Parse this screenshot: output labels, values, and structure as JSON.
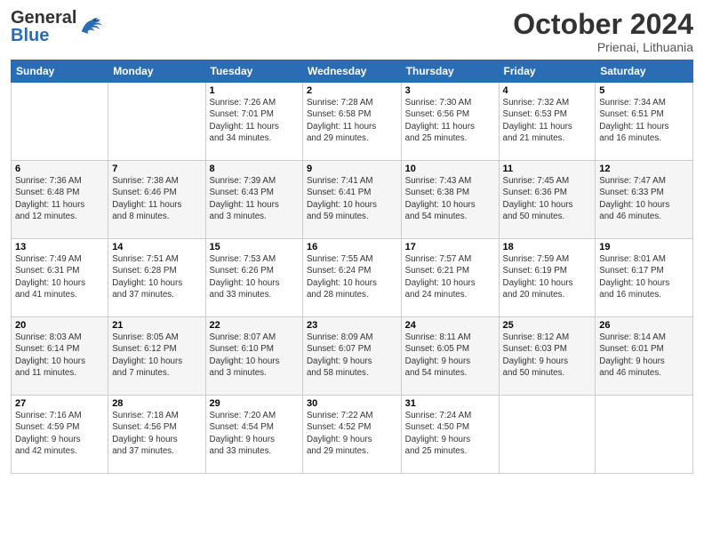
{
  "header": {
    "logo_general": "General",
    "logo_blue": "Blue",
    "month": "October 2024",
    "location": "Prienai, Lithuania"
  },
  "weekdays": [
    "Sunday",
    "Monday",
    "Tuesday",
    "Wednesday",
    "Thursday",
    "Friday",
    "Saturday"
  ],
  "weeks": [
    [
      {
        "day": "",
        "info": ""
      },
      {
        "day": "",
        "info": ""
      },
      {
        "day": "1",
        "info": "Sunrise: 7:26 AM\nSunset: 7:01 PM\nDaylight: 11 hours\nand 34 minutes."
      },
      {
        "day": "2",
        "info": "Sunrise: 7:28 AM\nSunset: 6:58 PM\nDaylight: 11 hours\nand 29 minutes."
      },
      {
        "day": "3",
        "info": "Sunrise: 7:30 AM\nSunset: 6:56 PM\nDaylight: 11 hours\nand 25 minutes."
      },
      {
        "day": "4",
        "info": "Sunrise: 7:32 AM\nSunset: 6:53 PM\nDaylight: 11 hours\nand 21 minutes."
      },
      {
        "day": "5",
        "info": "Sunrise: 7:34 AM\nSunset: 6:51 PM\nDaylight: 11 hours\nand 16 minutes."
      }
    ],
    [
      {
        "day": "6",
        "info": "Sunrise: 7:36 AM\nSunset: 6:48 PM\nDaylight: 11 hours\nand 12 minutes."
      },
      {
        "day": "7",
        "info": "Sunrise: 7:38 AM\nSunset: 6:46 PM\nDaylight: 11 hours\nand 8 minutes."
      },
      {
        "day": "8",
        "info": "Sunrise: 7:39 AM\nSunset: 6:43 PM\nDaylight: 11 hours\nand 3 minutes."
      },
      {
        "day": "9",
        "info": "Sunrise: 7:41 AM\nSunset: 6:41 PM\nDaylight: 10 hours\nand 59 minutes."
      },
      {
        "day": "10",
        "info": "Sunrise: 7:43 AM\nSunset: 6:38 PM\nDaylight: 10 hours\nand 54 minutes."
      },
      {
        "day": "11",
        "info": "Sunrise: 7:45 AM\nSunset: 6:36 PM\nDaylight: 10 hours\nand 50 minutes."
      },
      {
        "day": "12",
        "info": "Sunrise: 7:47 AM\nSunset: 6:33 PM\nDaylight: 10 hours\nand 46 minutes."
      }
    ],
    [
      {
        "day": "13",
        "info": "Sunrise: 7:49 AM\nSunset: 6:31 PM\nDaylight: 10 hours\nand 41 minutes."
      },
      {
        "day": "14",
        "info": "Sunrise: 7:51 AM\nSunset: 6:28 PM\nDaylight: 10 hours\nand 37 minutes."
      },
      {
        "day": "15",
        "info": "Sunrise: 7:53 AM\nSunset: 6:26 PM\nDaylight: 10 hours\nand 33 minutes."
      },
      {
        "day": "16",
        "info": "Sunrise: 7:55 AM\nSunset: 6:24 PM\nDaylight: 10 hours\nand 28 minutes."
      },
      {
        "day": "17",
        "info": "Sunrise: 7:57 AM\nSunset: 6:21 PM\nDaylight: 10 hours\nand 24 minutes."
      },
      {
        "day": "18",
        "info": "Sunrise: 7:59 AM\nSunset: 6:19 PM\nDaylight: 10 hours\nand 20 minutes."
      },
      {
        "day": "19",
        "info": "Sunrise: 8:01 AM\nSunset: 6:17 PM\nDaylight: 10 hours\nand 16 minutes."
      }
    ],
    [
      {
        "day": "20",
        "info": "Sunrise: 8:03 AM\nSunset: 6:14 PM\nDaylight: 10 hours\nand 11 minutes."
      },
      {
        "day": "21",
        "info": "Sunrise: 8:05 AM\nSunset: 6:12 PM\nDaylight: 10 hours\nand 7 minutes."
      },
      {
        "day": "22",
        "info": "Sunrise: 8:07 AM\nSunset: 6:10 PM\nDaylight: 10 hours\nand 3 minutes."
      },
      {
        "day": "23",
        "info": "Sunrise: 8:09 AM\nSunset: 6:07 PM\nDaylight: 9 hours\nand 58 minutes."
      },
      {
        "day": "24",
        "info": "Sunrise: 8:11 AM\nSunset: 6:05 PM\nDaylight: 9 hours\nand 54 minutes."
      },
      {
        "day": "25",
        "info": "Sunrise: 8:12 AM\nSunset: 6:03 PM\nDaylight: 9 hours\nand 50 minutes."
      },
      {
        "day": "26",
        "info": "Sunrise: 8:14 AM\nSunset: 6:01 PM\nDaylight: 9 hours\nand 46 minutes."
      }
    ],
    [
      {
        "day": "27",
        "info": "Sunrise: 7:16 AM\nSunset: 4:59 PM\nDaylight: 9 hours\nand 42 minutes."
      },
      {
        "day": "28",
        "info": "Sunrise: 7:18 AM\nSunset: 4:56 PM\nDaylight: 9 hours\nand 37 minutes."
      },
      {
        "day": "29",
        "info": "Sunrise: 7:20 AM\nSunset: 4:54 PM\nDaylight: 9 hours\nand 33 minutes."
      },
      {
        "day": "30",
        "info": "Sunrise: 7:22 AM\nSunset: 4:52 PM\nDaylight: 9 hours\nand 29 minutes."
      },
      {
        "day": "31",
        "info": "Sunrise: 7:24 AM\nSunset: 4:50 PM\nDaylight: 9 hours\nand 25 minutes."
      },
      {
        "day": "",
        "info": ""
      },
      {
        "day": "",
        "info": ""
      }
    ]
  ]
}
